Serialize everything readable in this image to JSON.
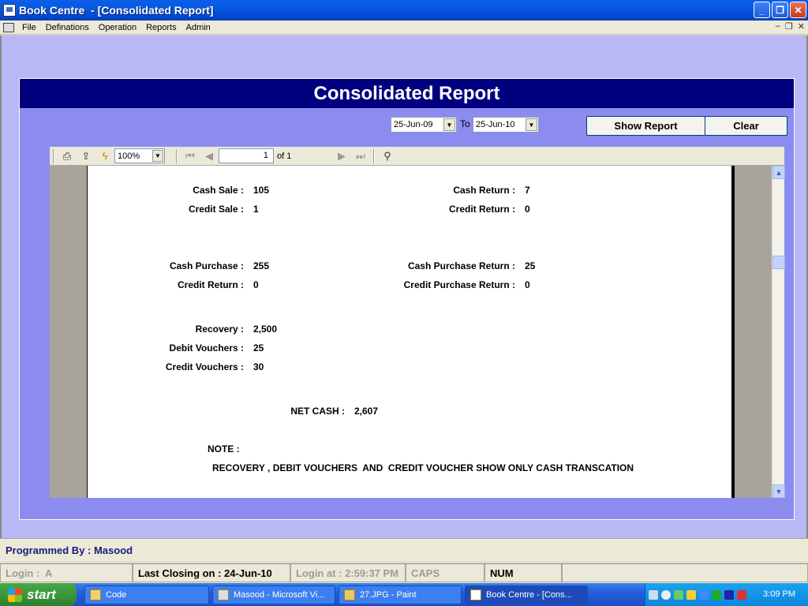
{
  "window": {
    "title": "Book Centre  - [Consolidated Report]"
  },
  "menu": {
    "items": [
      "File",
      "Definations",
      "Operation",
      "Reports",
      "Admin"
    ]
  },
  "report": {
    "header": "Consolidated Report",
    "from_date": "25-Jun-09",
    "to_label": "To",
    "to_date": "25-Jun-10",
    "show_button": "Show Report",
    "clear_button": "Clear"
  },
  "viewer": {
    "zoom": "100%",
    "page": "1",
    "of_pages": "of 1"
  },
  "fields": {
    "cash_sale": {
      "label": "Cash Sale :",
      "value": "105"
    },
    "credit_sale": {
      "label": "Credit Sale :",
      "value": "1"
    },
    "cash_return": {
      "label": "Cash Return :",
      "value": "7"
    },
    "credit_return_sale": {
      "label": "Credit Return :",
      "value": "0"
    },
    "cash_purchase": {
      "label": "Cash Purchase :",
      "value": "255"
    },
    "credit_return_purchase": {
      "label": "Credit Return :",
      "value": "0"
    },
    "cash_purchase_return": {
      "label": "Cash Purchase Return :",
      "value": "25"
    },
    "credit_purchase_return": {
      "label": "Credit Purchase Return :",
      "value": "0"
    },
    "recovery": {
      "label": "Recovery :",
      "value": "2,500"
    },
    "debit_vouchers": {
      "label": "Debit Vouchers :",
      "value": "25"
    },
    "credit_vouchers": {
      "label": "Credit Vouchers :",
      "value": "30"
    },
    "net_cash": {
      "label": "NET CASH :",
      "value": "2,607"
    }
  },
  "note": {
    "label": "NOTE :",
    "text": "RECOVERY , DEBIT VOUCHERS  AND  CREDIT VOUCHER SHOW ONLY CASH TRANSCATION"
  },
  "footer": {
    "programmed_by": "Programmed By : Masood"
  },
  "status": {
    "login": "Login :  A",
    "last_closing": "Last Closing on : 24-Jun-10",
    "login_at": "Login at : 2:59:37 PM",
    "caps": "CAPS",
    "num": "NUM"
  },
  "taskbar": {
    "start": "start",
    "tasks": [
      "Code",
      "Masood - Microsoft Vi...",
      "27.JPG - Paint",
      "Book Centre  - [Cons..."
    ],
    "clock": "3:09 PM"
  }
}
